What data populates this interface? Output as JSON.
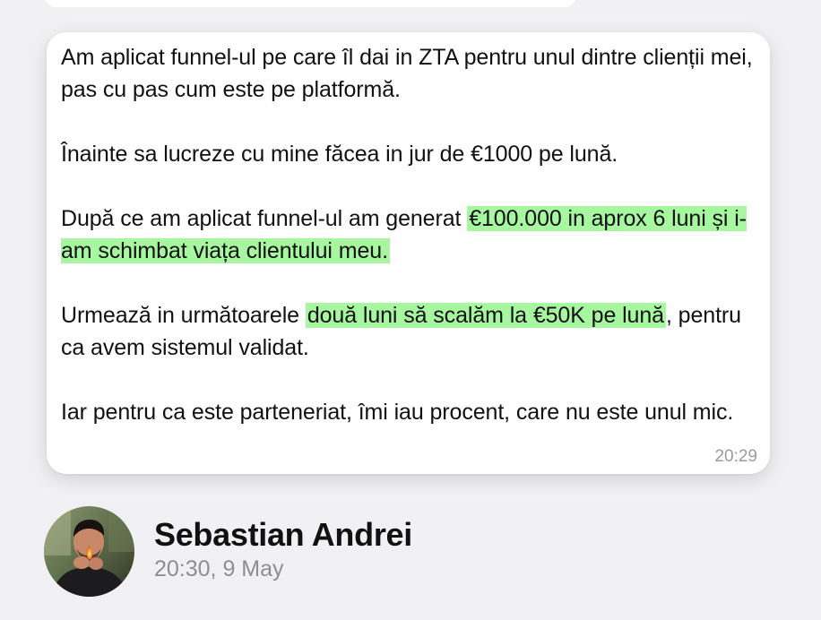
{
  "message": {
    "paragraphs": [
      {
        "segments": [
          {
            "text": "Am aplicat funnel-ul pe care îl dai in ZTA pentru unul dintre clienții mei, pas cu pas cum este pe platformă.",
            "highlight": false
          }
        ]
      },
      {
        "segments": [
          {
            "text": "Înainte sa lucreze cu mine făcea in jur de €1000 pe lună.",
            "highlight": false
          }
        ]
      },
      {
        "segments": [
          {
            "text": "După ce am aplicat funnel-ul am generat ",
            "highlight": false
          },
          {
            "text": "€100.000 in aprox 6 luni și i-am schimbat viața clientului meu.",
            "highlight": true
          }
        ]
      },
      {
        "segments": [
          {
            "text": "Urmează in următoarele ",
            "highlight": false
          },
          {
            "text": "două luni să scalăm la €50K pe lună",
            "highlight": true
          },
          {
            "text": ", pentru ca avem sistemul validat.",
            "highlight": false
          }
        ]
      },
      {
        "segments": [
          {
            "text": "Iar pentru ca este parteneriat, îmi iau procent, care nu este unul mic.",
            "highlight": false
          }
        ]
      }
    ],
    "time": "20:29",
    "highlight_color": "#a6f7a0"
  },
  "author": {
    "name": "Sebastian Andrei",
    "timestamp": "20:30, 9 May",
    "avatar_icon": "profile-photo"
  }
}
